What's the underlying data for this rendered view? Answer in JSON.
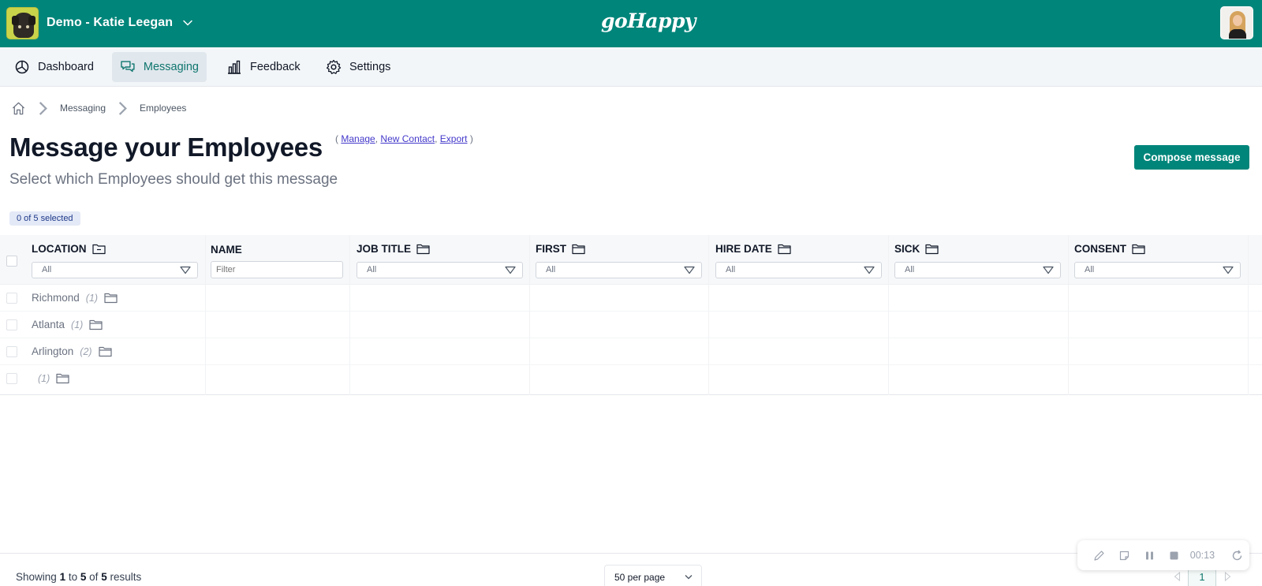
{
  "header": {
    "account_name": "Demo - Katie Leegan",
    "logo_text": "goHappy"
  },
  "nav": {
    "items": [
      {
        "label": "Dashboard",
        "icon": "pie-chart-icon"
      },
      {
        "label": "Messaging",
        "icon": "chat-bubbles-icon",
        "active": true
      },
      {
        "label": "Feedback",
        "icon": "bar-chart-icon"
      },
      {
        "label": "Settings",
        "icon": "gear-icon"
      }
    ]
  },
  "breadcrumb": {
    "items": [
      "Messaging",
      "Employees"
    ]
  },
  "page": {
    "title": "Message your Employees",
    "links": {
      "open": "(",
      "manage": "Manage",
      "comma1": ",",
      "new_contact": "New Contact",
      "comma2": ",",
      "export": "Export",
      "close": ")"
    },
    "subtitle": "Select which Employees should get this message",
    "compose_label": "Compose message",
    "selected_text": "0 of 5 selected"
  },
  "table": {
    "columns": [
      {
        "title": "LOCATION",
        "filter": "All"
      },
      {
        "title": "NAME",
        "filter_placeholder": "Filter"
      },
      {
        "title": "JOB TITLE",
        "filter": "All"
      },
      {
        "title": "FIRST",
        "filter": "All"
      },
      {
        "title": "HIRE DATE",
        "filter": "All"
      },
      {
        "title": "SICK",
        "filter": "All"
      },
      {
        "title": "CONSENT",
        "filter": "All"
      }
    ],
    "rows": [
      {
        "label": "Richmond",
        "count": "(1)"
      },
      {
        "label": "Atlanta",
        "count": "(1)"
      },
      {
        "label": "Arlington",
        "count": "(2)"
      },
      {
        "label": "",
        "count": "(1)"
      }
    ]
  },
  "footer": {
    "results_prefix": "Showing",
    "from": "1",
    "to_word": "to",
    "to": "5",
    "of_word": "of",
    "total": "5",
    "results_suffix": "results",
    "per_page": "50 per page",
    "current_page": "1"
  },
  "recorder": {
    "timer": "00:13"
  },
  "colors": {
    "brand": "#00857a",
    "nav_bg": "#f3f6f8",
    "active_nav": "#e0e7ed",
    "link": "#4338ca"
  }
}
